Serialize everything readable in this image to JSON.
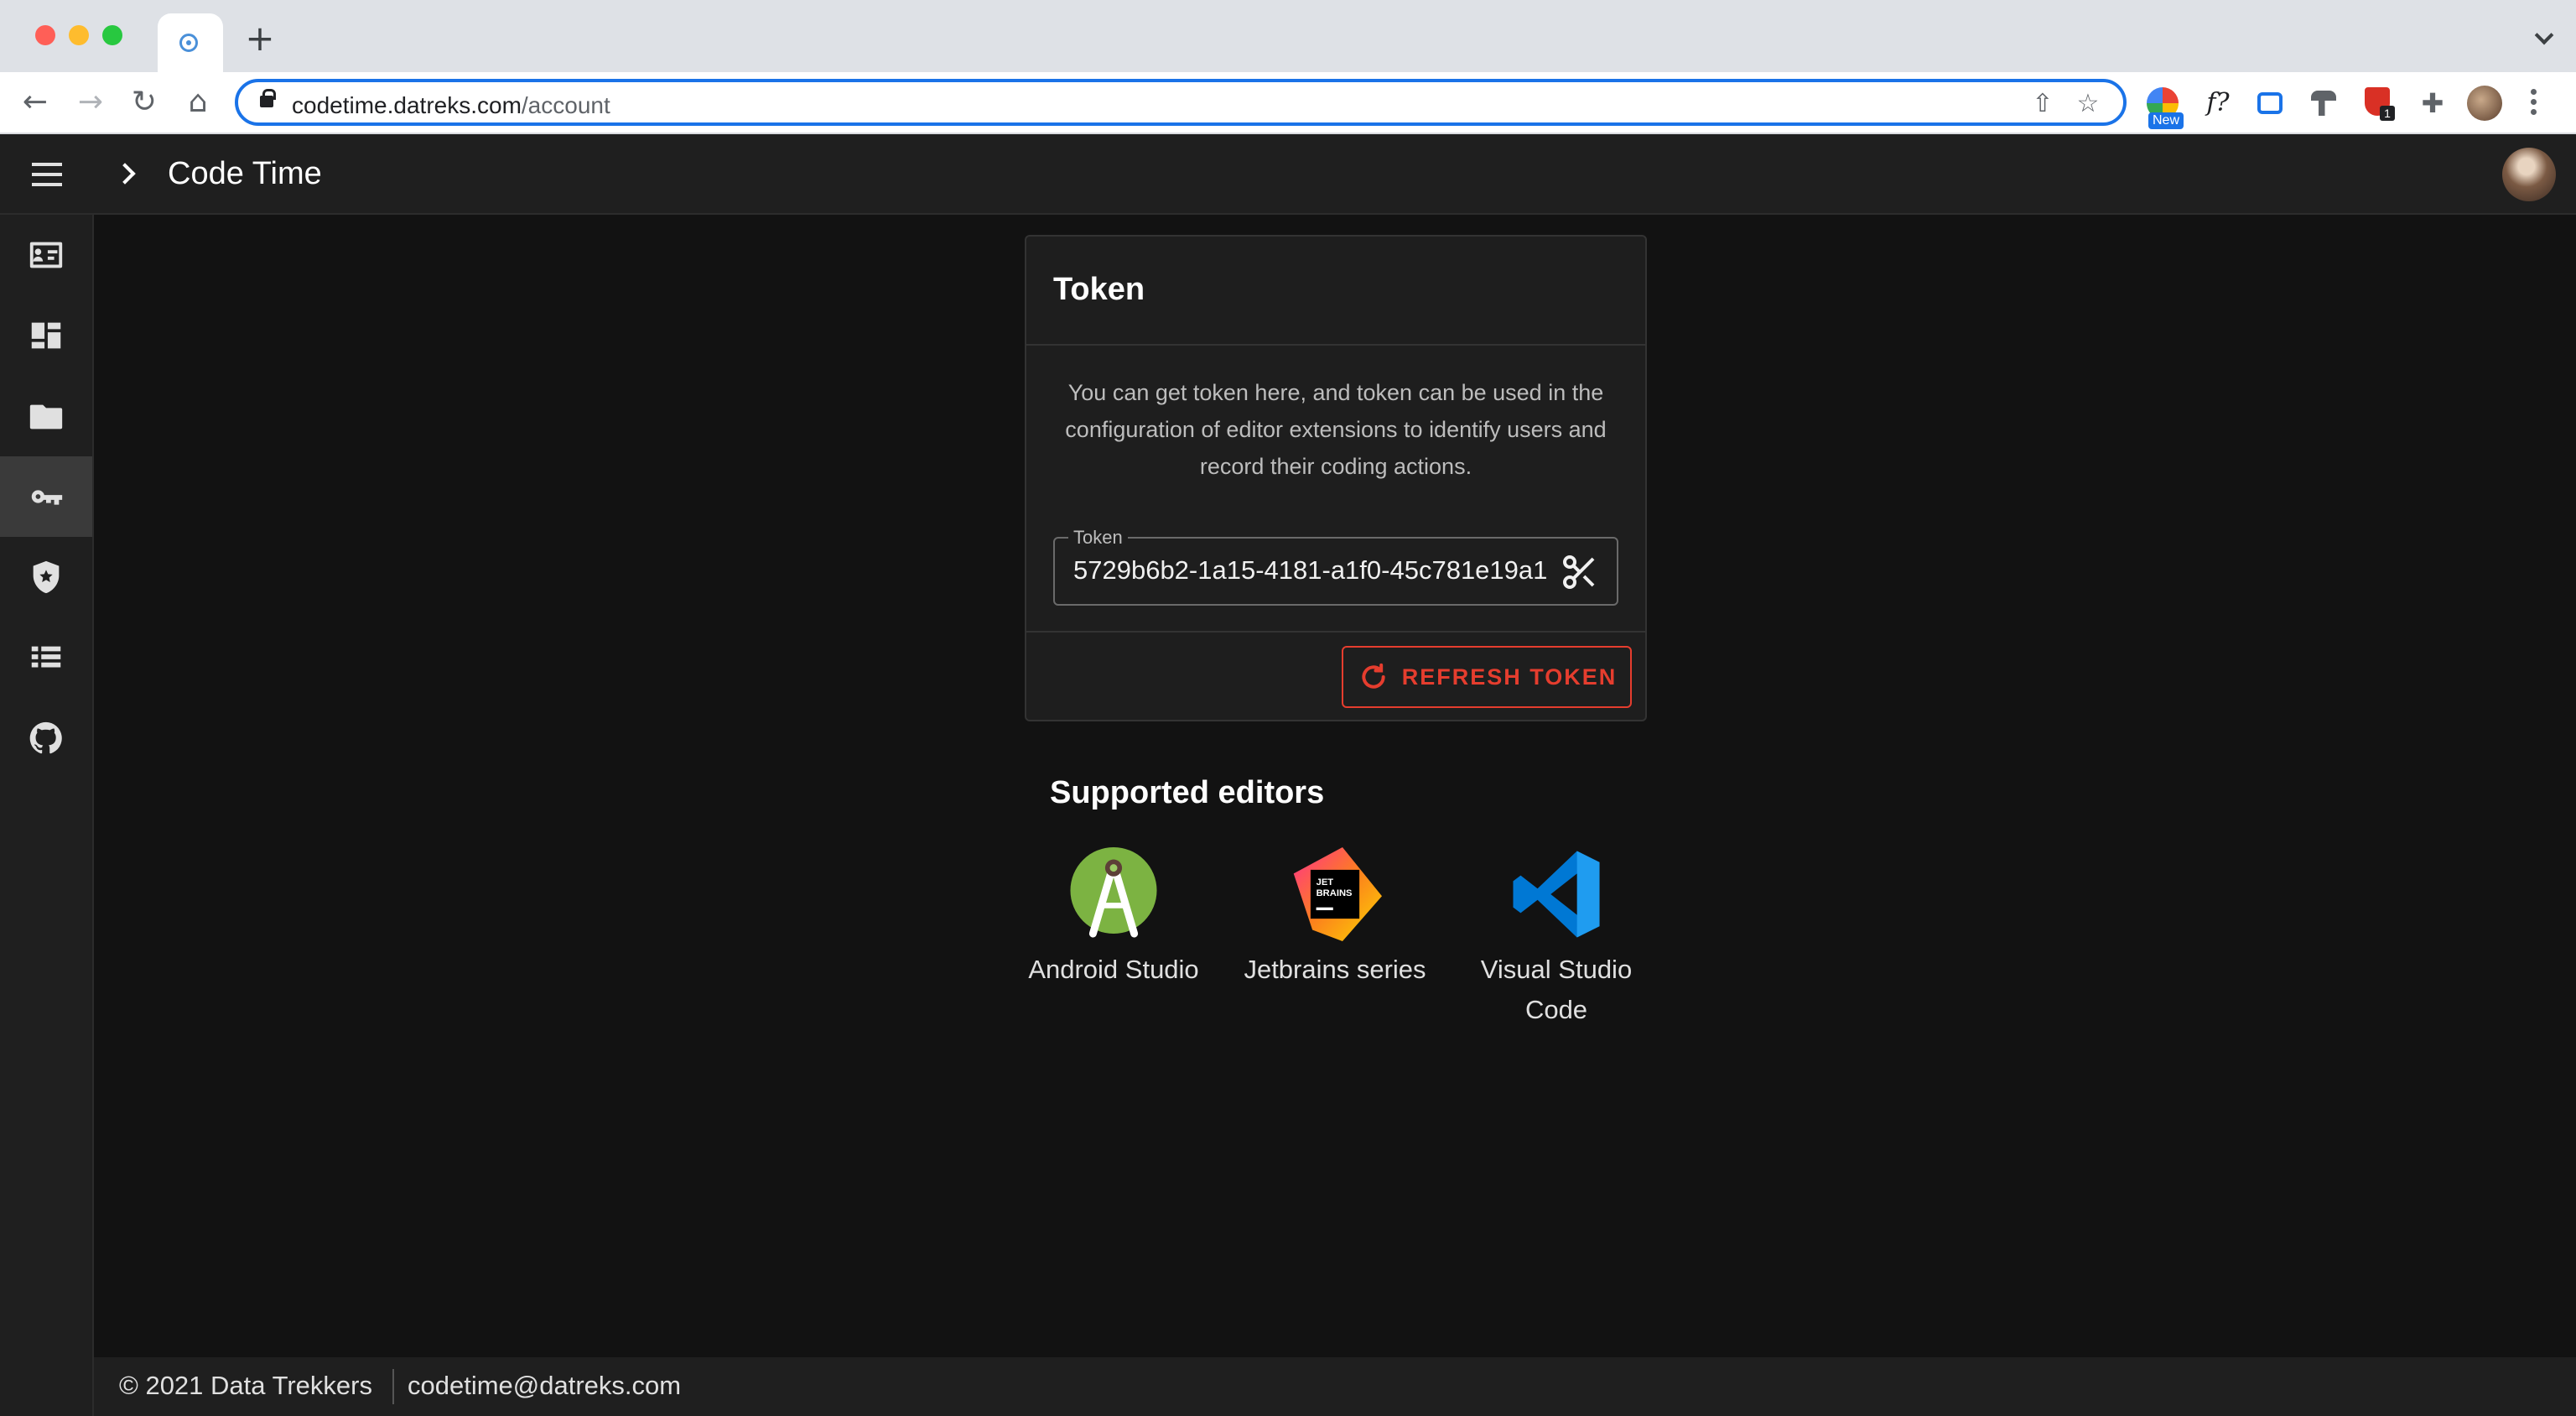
{
  "browser": {
    "url_host": "codetime.datreks.com",
    "url_path": "/account",
    "extension_badge_new": "New",
    "extension_badge_count": "1",
    "ext_formula_label": "f?"
  },
  "app": {
    "title": "Code Time"
  },
  "sidebar": {
    "items": [
      {
        "icon": "account-card-icon",
        "active": false
      },
      {
        "icon": "dashboard-icon",
        "active": false
      },
      {
        "icon": "folder-icon",
        "active": false
      },
      {
        "icon": "key-icon",
        "active": true
      },
      {
        "icon": "shield-star-icon",
        "active": false
      },
      {
        "icon": "list-icon",
        "active": false
      },
      {
        "icon": "github-icon",
        "active": false
      }
    ]
  },
  "token_card": {
    "title": "Token",
    "description": "You can get token here, and token can be used in the configuration of editor extensions to identify users and record their coding actions.",
    "field_label": "Token",
    "field_value": "5729b6b2-1a15-4181-a1f0-45c781e19a1",
    "refresh_label": "REFRESH TOKEN"
  },
  "editors": {
    "title": "Supported editors",
    "items": [
      {
        "label": "Android Studio",
        "icon": "android-studio-icon"
      },
      {
        "label": "Jetbrains series",
        "icon": "jetbrains-icon"
      },
      {
        "label": "Visual Studio Code",
        "icon": "vscode-icon"
      }
    ]
  },
  "footer": {
    "copyright": "© 2021 Data Trekkers",
    "email": "codetime@datreks.com"
  },
  "colors": {
    "accent": "#e53d2e",
    "background": "#121212",
    "surface": "#1e1e1e"
  }
}
